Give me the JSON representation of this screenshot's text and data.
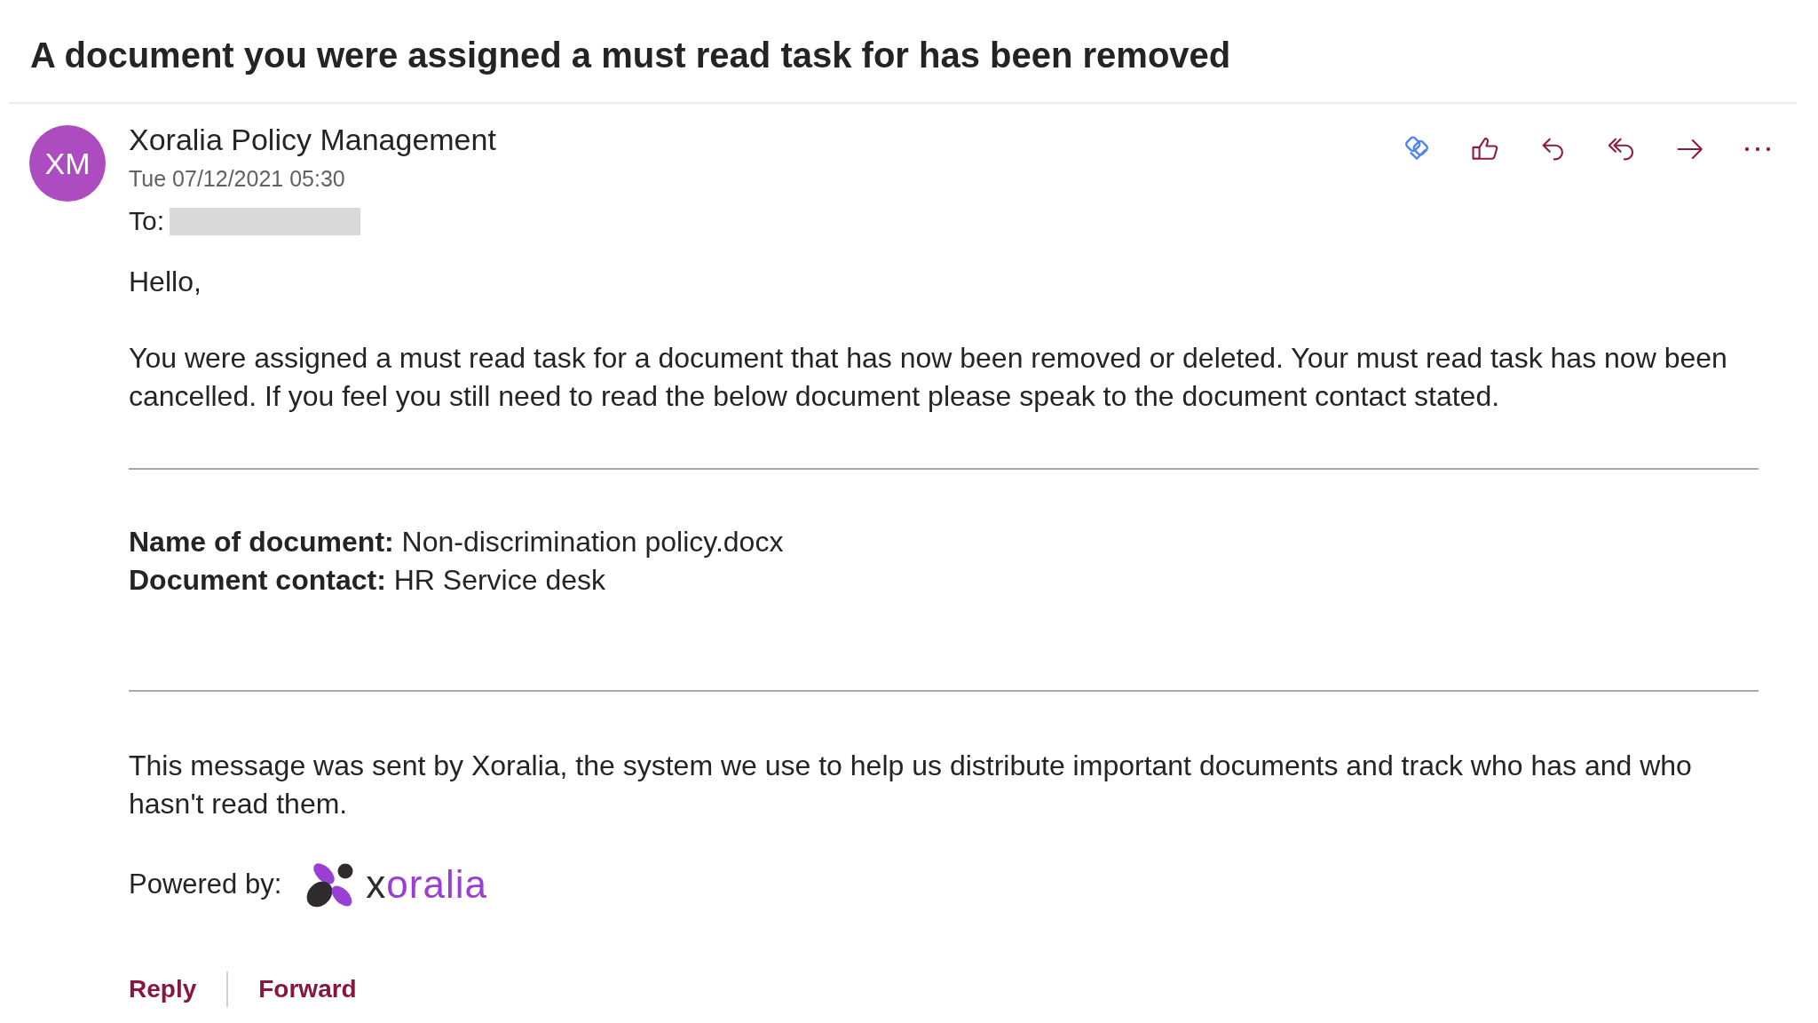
{
  "subject": "A document you were assigned a must read task for has been removed",
  "sender": {
    "initials": "XM",
    "name": "Xoralia Policy Management"
  },
  "sent": "Tue 07/12/2021 05:30",
  "recipient": {
    "label": "To:",
    "redacted": true
  },
  "body": {
    "greeting": "Hello,",
    "paragraph": "You were assigned a must read task for a document that has now been removed or deleted. Your must read task has now been cancelled. If you feel you still need to read the below document please speak to the document contact stated.",
    "details": [
      "**Name of document:** Non-discrimination policy.docx",
      "**Document contact:** HR Service desk"
    ],
    "note": "This message was sent by Xoralia, the system we use to help us distribute important documents and track who has and who hasn't read them.",
    "powered_by": {
      "label": "Powered by:",
      "wordmark": "xoralia"
    }
  },
  "actions": [
    "Reply",
    "Forward"
  ]
}
